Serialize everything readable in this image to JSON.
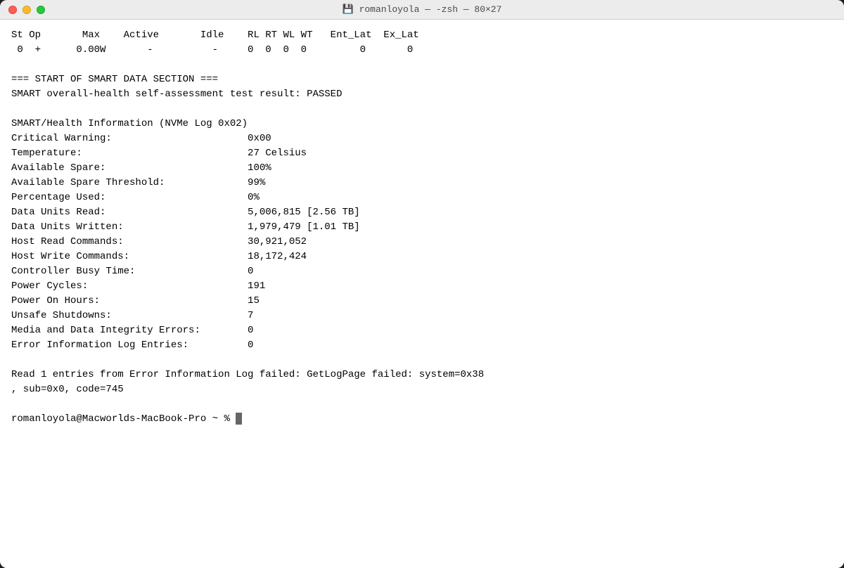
{
  "titlebar": {
    "title": "💾 romanloyola — -zsh — 80×27"
  },
  "terminal": {
    "lines": [
      "St Op       Max    Active       Idle    RL RT WL WT   Ent_Lat  Ex_Lat",
      " 0  +      0.00W       -          -     0  0  0  0         0       0",
      "",
      "=== START OF SMART DATA SECTION ===",
      "SMART overall-health self-assessment test result: PASSED",
      "",
      "SMART/Health Information (NVMe Log 0x02)",
      "Critical Warning:                       0x00",
      "Temperature:                            27 Celsius",
      "Available Spare:                        100%",
      "Available Spare Threshold:              99%",
      "Percentage Used:                        0%",
      "Data Units Read:                        5,006,815 [2.56 TB]",
      "Data Units Written:                     1,979,479 [1.01 TB]",
      "Host Read Commands:                     30,921,052",
      "Host Write Commands:                    18,172,424",
      "Controller Busy Time:                   0",
      "Power Cycles:                           191",
      "Power On Hours:                         15",
      "Unsafe Shutdowns:                       7",
      "Media and Data Integrity Errors:        0",
      "Error Information Log Entries:          0",
      "",
      "Read 1 entries from Error Information Log failed: GetLogPage failed: system=0x38",
      ", sub=0x0, code=745",
      "",
      "romanloyola@Macworlds-MacBook-Pro ~ % "
    ],
    "prompt": "romanloyola@Macworlds-MacBook-Pro ~ % "
  }
}
